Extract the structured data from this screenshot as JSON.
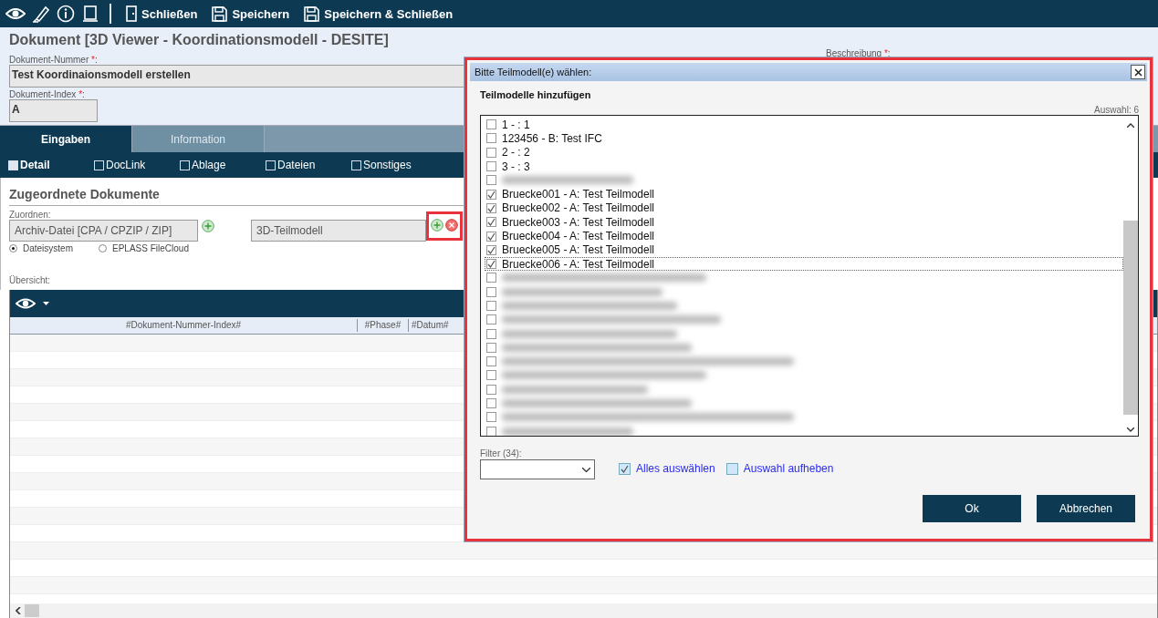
{
  "toolbar": {
    "buttons": [
      {
        "label": "Schließen",
        "kind": "door"
      },
      {
        "label": "Speichern",
        "kind": "disk"
      },
      {
        "label": "Speichern & Schließen",
        "kind": "disk"
      }
    ]
  },
  "document": {
    "title": "Dokument [3D Viewer - Koordinationsmodell - DESITE]",
    "fields": [
      {
        "label": "Dokument-Nummer",
        "mark": "*",
        "colon": ":",
        "value": "Test Koordinaionsmodell erstellen"
      },
      {
        "label": "Dokument-Index",
        "mark": "*",
        "colon": ":",
        "value": "A"
      }
    ],
    "side_label": {
      "label": "Beschreibung",
      "mark": "*",
      "colon": ":"
    }
  },
  "tabs": [
    {
      "label": "Eingaben",
      "selected": true
    },
    {
      "label": "Information",
      "selected": false
    }
  ],
  "subtabs": [
    {
      "label": "Detail",
      "selected": true
    },
    {
      "label": "DocLink",
      "selected": false
    },
    {
      "label": "Ablage",
      "selected": false
    },
    {
      "label": "Dateien",
      "selected": false
    },
    {
      "label": "Sonstiges",
      "selected": false
    }
  ],
  "section": {
    "title": "Zugeordnete Dokumente",
    "assign_label": "Zuordnen:",
    "archive_field": "Archiv-Datei [CPA / CPZIP / ZIP]",
    "sources": [
      {
        "label": "Dateisystem",
        "selected": true
      },
      {
        "label": "EPLASS FileCloud",
        "selected": false
      }
    ],
    "model_field": "3D-Teilmodell",
    "overview_label": "Übersicht:"
  },
  "table": {
    "columns": [
      "#Dokument-Nummer-Index#",
      "#Phase#",
      "#Datum#"
    ]
  },
  "dialog": {
    "title": "Bitte Teilmodell(e) wählen:",
    "heading": "Teilmodelle hinzufügen",
    "count": "Auswahl: 6",
    "items": [
      {
        "kind": "text",
        "label": "1 - : 1",
        "checked": false,
        "focused": false
      },
      {
        "kind": "text",
        "label": "123456 - B: Test IFC",
        "checked": false,
        "focused": false
      },
      {
        "kind": "text",
        "label": "2 - : 2",
        "checked": false,
        "focused": false
      },
      {
        "kind": "text",
        "label": "3 - : 3",
        "checked": false,
        "focused": false
      },
      {
        "kind": "blurred",
        "checked": false
      },
      {
        "kind": "text",
        "label": "Bruecke001 - A: Test Teilmodell",
        "checked": true,
        "focused": false
      },
      {
        "kind": "text",
        "label": "Bruecke002 - A: Test Teilmodell",
        "checked": true,
        "focused": false
      },
      {
        "kind": "text",
        "label": "Bruecke003 - A: Test Teilmodell",
        "checked": true,
        "focused": false
      },
      {
        "kind": "text",
        "label": "Bruecke004 - A: Test Teilmodell",
        "checked": true,
        "focused": false
      },
      {
        "kind": "text",
        "label": "Bruecke005 - A: Test Teilmodell",
        "checked": true,
        "focused": false
      },
      {
        "kind": "text",
        "label": "Bruecke006 - A: Test Teilmodell",
        "checked": true,
        "focused": true
      },
      {
        "kind": "blurred",
        "checked": false
      },
      {
        "kind": "blurred",
        "checked": false
      },
      {
        "kind": "blurred",
        "checked": false
      },
      {
        "kind": "blurred",
        "checked": false
      },
      {
        "kind": "blurred",
        "checked": false
      },
      {
        "kind": "blurred",
        "checked": false
      },
      {
        "kind": "blurred",
        "checked": false
      },
      {
        "kind": "blurred",
        "checked": false
      },
      {
        "kind": "blurred",
        "checked": false
      },
      {
        "kind": "blurred",
        "checked": false
      },
      {
        "kind": "blurred",
        "checked": false
      },
      {
        "kind": "blurred",
        "checked": false
      }
    ],
    "filter_label": "Filter (34):",
    "options": [
      {
        "label": "Alles auswählen",
        "checked": true
      },
      {
        "label": "Auswahl aufheben",
        "checked": false
      }
    ],
    "buttons": [
      "Ok",
      "Abbrechen"
    ]
  }
}
